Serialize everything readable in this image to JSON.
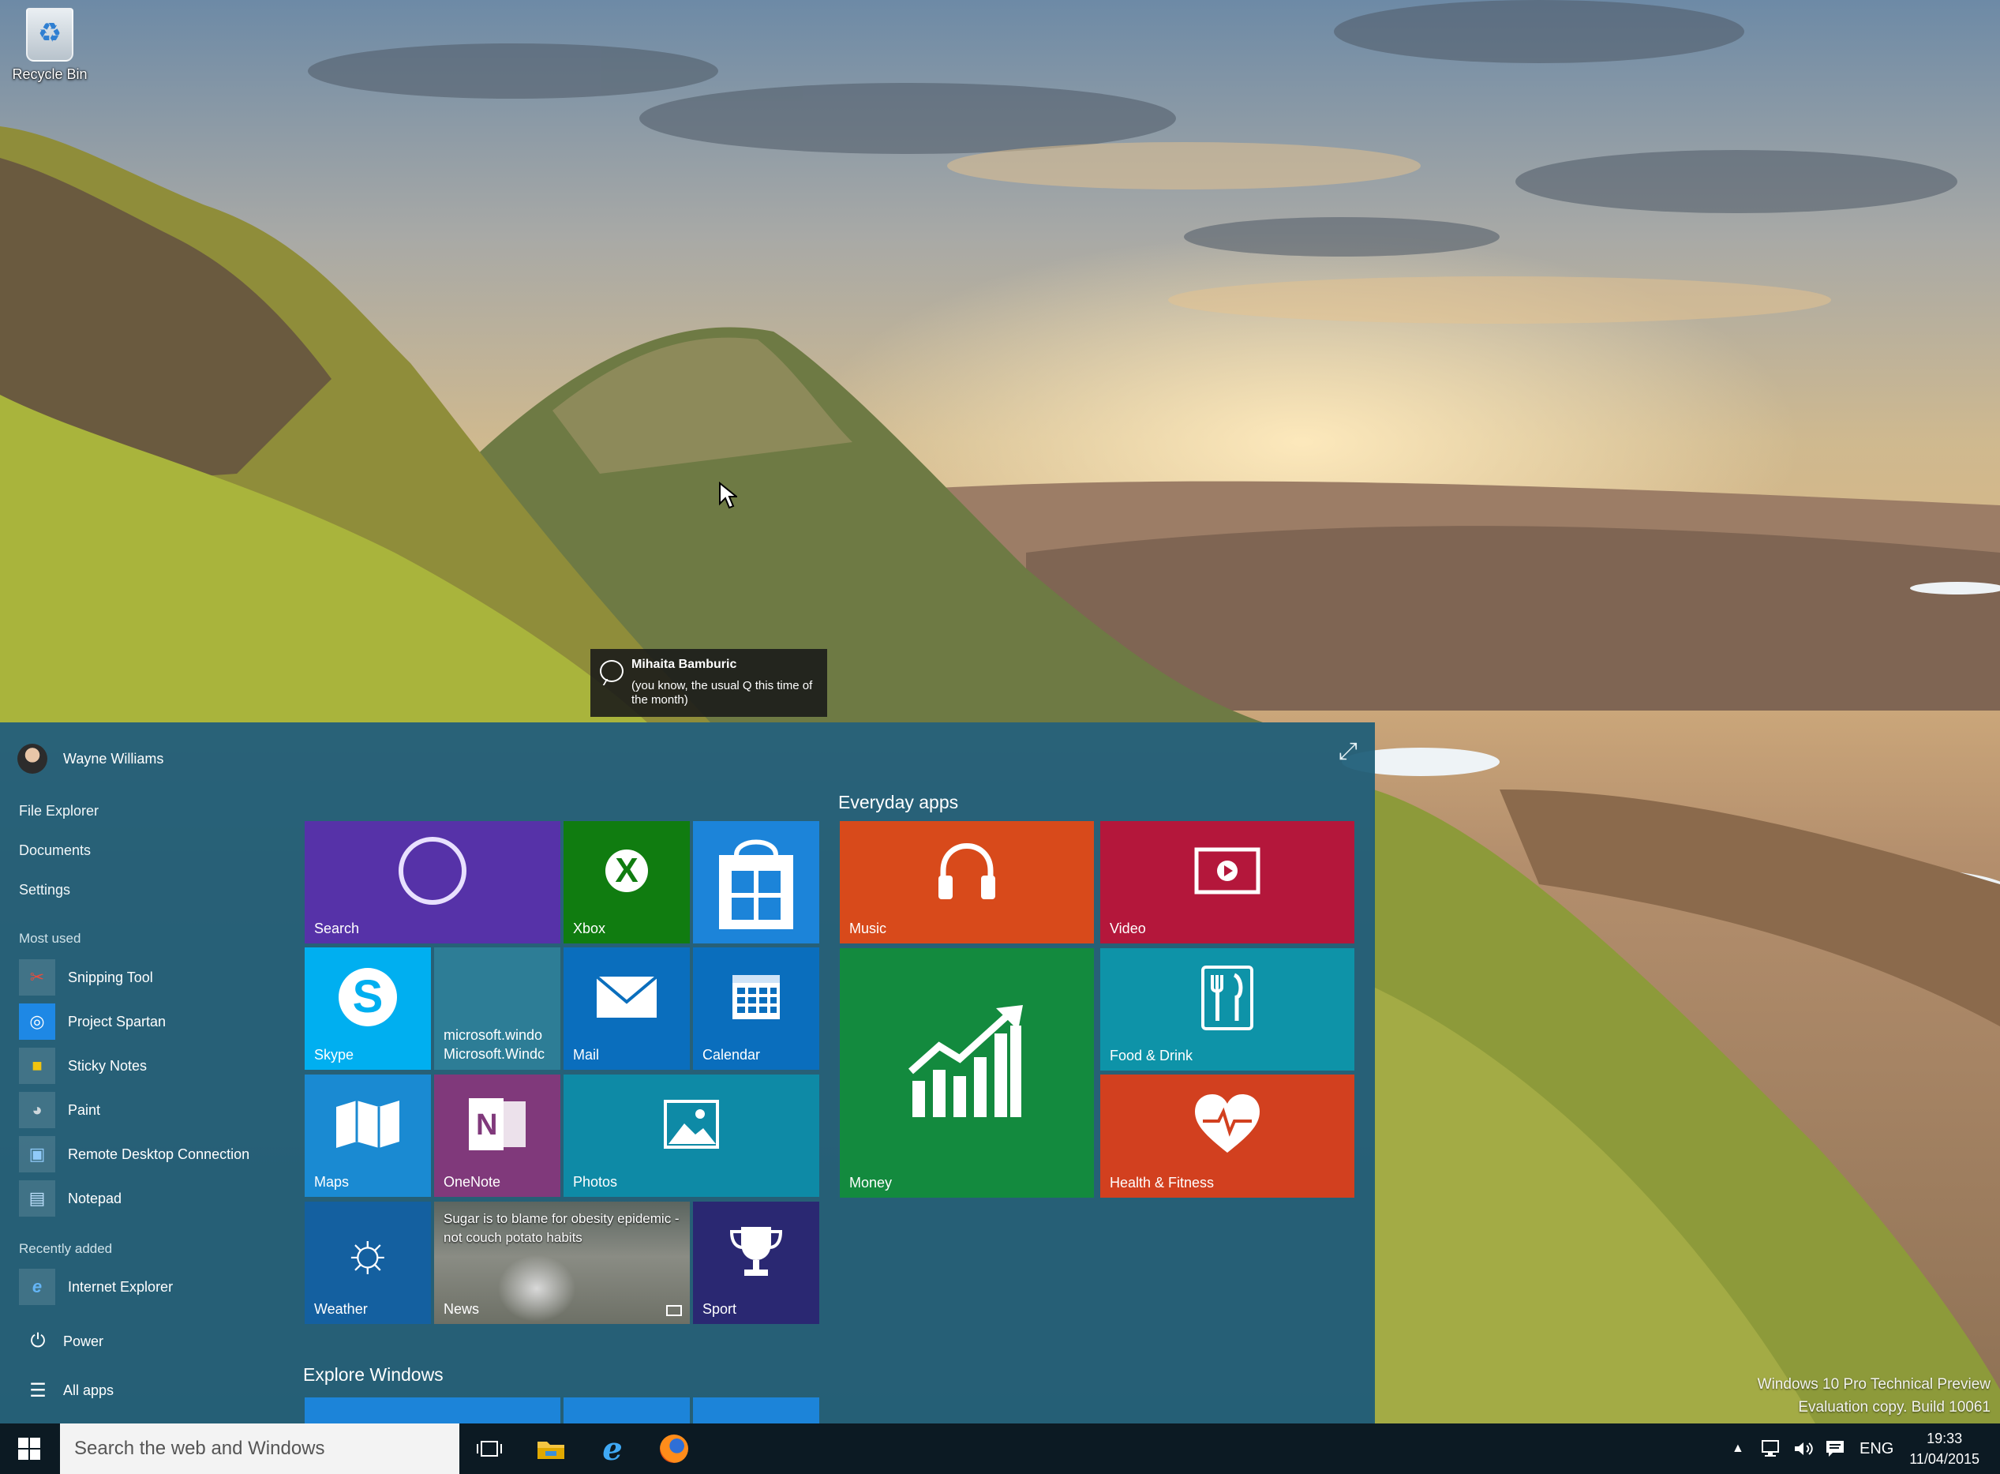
{
  "desktop": {
    "recycle_bin_label": "Recycle Bin",
    "watermark_line1": "Windows 10 Pro Technical Preview",
    "watermark_line2": "Evaluation copy. Build 10061"
  },
  "toast": {
    "sender": "Mihaita Bamburic",
    "message": "(you know,  the usual Q this time of the month)"
  },
  "start_menu": {
    "user_name": "Wayne Williams",
    "places": [
      "File Explorer",
      "Documents",
      "Settings"
    ],
    "most_used_header": "Most used",
    "most_used": [
      {
        "label": "Snipping Tool",
        "icon": "scissors-icon",
        "color": "#c0392b"
      },
      {
        "label": "Project Spartan",
        "icon": "globe-icon",
        "color": "#1e88e5"
      },
      {
        "label": "Sticky Notes",
        "icon": "note-icon",
        "color": "#f1c40f"
      },
      {
        "label": "Paint",
        "icon": "palette-icon",
        "color": "#8e9aaa"
      },
      {
        "label": "Remote Desktop Connection",
        "icon": "monitor-icon",
        "color": "#3f7fbf"
      },
      {
        "label": "Notepad",
        "icon": "notepad-icon",
        "color": "#7fb3d5"
      }
    ],
    "recently_added_header": "Recently added",
    "recently_added": [
      {
        "label": "Internet Explorer",
        "icon": "ie-icon",
        "color": "#1e88e5"
      }
    ],
    "power_label": "Power",
    "all_apps_label": "All apps",
    "everyday_apps_title": "Everyday apps",
    "explore_windows_title": "Explore Windows",
    "tiles_left": {
      "search": "Search",
      "xbox": "Xbox",
      "skype": "Skype",
      "windows_app_line1": "microsoft.windo",
      "windows_app_line2": "Microsoft.Windc",
      "mail": "Mail",
      "calendar": "Calendar",
      "maps": "Maps",
      "onenote": "OneNote",
      "photos": "Photos",
      "weather": "Weather",
      "news": "News",
      "news_headline": "Sugar is to blame for obesity epidemic - not couch potato habits",
      "sport": "Sport"
    },
    "tiles_everyday": {
      "music": "Music",
      "video": "Video",
      "money": "Money",
      "food": "Food & Drink",
      "health": "Health & Fitness"
    },
    "colors": {
      "search": "#5632a8",
      "xbox": "#107c10",
      "store": "#1c84d9",
      "skype": "#00aff0",
      "windows_app": "#2d7d96",
      "mail": "#0a6ebd",
      "calendar": "#0a6ebd",
      "maps": "#1a8ad2",
      "onenote": "#80397b",
      "photos": "#0e8aa6",
      "weather": "#1460a0",
      "sport": "#2a2872",
      "music": "#d84a1b",
      "video": "#b4173b",
      "money": "#138a3e",
      "food": "#0e93a8",
      "health": "#d2401f"
    }
  },
  "taskbar": {
    "search_placeholder": "Search the web and Windows",
    "language": "ENG",
    "time": "19:33",
    "date": "11/04/2015"
  }
}
